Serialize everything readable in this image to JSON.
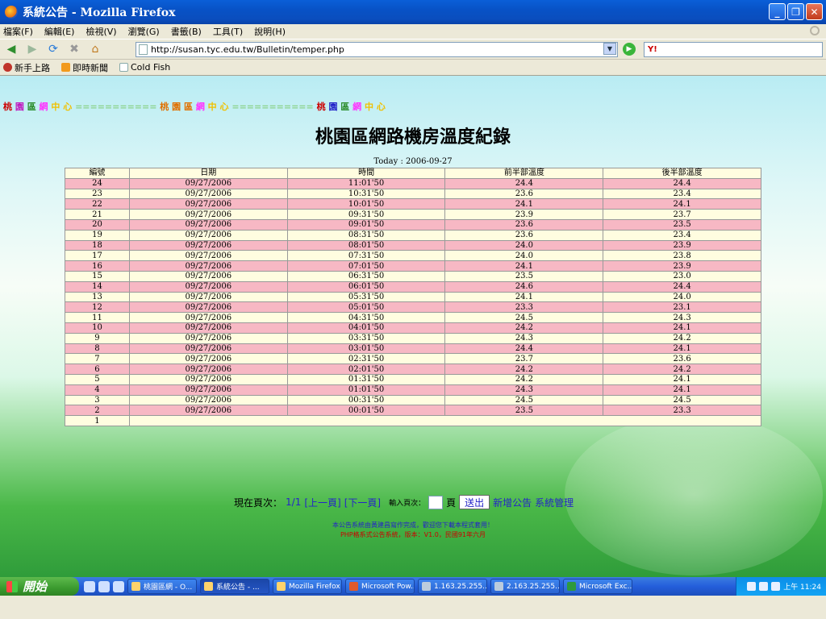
{
  "window": {
    "title": "系統公告 - Mozilla Firefox",
    "controls": [
      "_",
      "❐",
      "✕"
    ]
  },
  "menu": [
    "檔案(F)",
    "編輯(E)",
    "檢視(V)",
    "瀏覽(G)",
    "書籤(B)",
    "工具(T)",
    "說明(H)"
  ],
  "nav": {
    "url": "http://susan.tyc.edu.tw/Bulletin/temper.php",
    "search_logo": "Y!"
  },
  "bookmarks": [
    "新手上路",
    "即時新聞",
    "Cold Fish"
  ],
  "marquee": {
    "seg1": [
      "桃",
      "園",
      "區",
      "網",
      "中",
      "心"
    ],
    "sep": "==========="
  },
  "page": {
    "title": "桃園區網路機房溫度紀錄",
    "today": "Today : 2006-09-27",
    "columns": [
      "編號",
      "日期",
      "時間",
      "前半部溫度",
      "後半部溫度"
    ],
    "rows": [
      [
        "24",
        "09/27/2006",
        "11:01'50",
        "24.4",
        "24.4"
      ],
      [
        "23",
        "09/27/2006",
        "10:31'50",
        "23.6",
        "23.4"
      ],
      [
        "22",
        "09/27/2006",
        "10:01'50",
        "24.1",
        "24.1"
      ],
      [
        "21",
        "09/27/2006",
        "09:31'50",
        "23.9",
        "23.7"
      ],
      [
        "20",
        "09/27/2006",
        "09:01'50",
        "23.6",
        "23.5"
      ],
      [
        "19",
        "09/27/2006",
        "08:31'50",
        "23.6",
        "23.4"
      ],
      [
        "18",
        "09/27/2006",
        "08:01'50",
        "24.0",
        "23.9"
      ],
      [
        "17",
        "09/27/2006",
        "07:31'50",
        "24.0",
        "23.8"
      ],
      [
        "16",
        "09/27/2006",
        "07:01'50",
        "24.1",
        "23.9"
      ],
      [
        "15",
        "09/27/2006",
        "06:31'50",
        "23.5",
        "23.0"
      ],
      [
        "14",
        "09/27/2006",
        "06:01'50",
        "24.6",
        "24.4"
      ],
      [
        "13",
        "09/27/2006",
        "05:31'50",
        "24.1",
        "24.0"
      ],
      [
        "12",
        "09/27/2006",
        "05:01'50",
        "23.3",
        "23.1"
      ],
      [
        "11",
        "09/27/2006",
        "04:31'50",
        "24.5",
        "24.3"
      ],
      [
        "10",
        "09/27/2006",
        "04:01'50",
        "24.2",
        "24.1"
      ],
      [
        "9",
        "09/27/2006",
        "03:31'50",
        "24.3",
        "24.2"
      ],
      [
        "8",
        "09/27/2006",
        "03:01'50",
        "24.4",
        "24.1"
      ],
      [
        "7",
        "09/27/2006",
        "02:31'50",
        "23.7",
        "23.6"
      ],
      [
        "6",
        "09/27/2006",
        "02:01'50",
        "24.2",
        "24.2"
      ],
      [
        "5",
        "09/27/2006",
        "01:31'50",
        "24.2",
        "24.1"
      ],
      [
        "4",
        "09/27/2006",
        "01:01'50",
        "24.3",
        "24.1"
      ],
      [
        "3",
        "09/27/2006",
        "00:31'50",
        "24.5",
        "24.5"
      ],
      [
        "2",
        "09/27/2006",
        "00:01'50",
        "23.5",
        "23.3"
      ],
      [
        "1"
      ]
    ]
  },
  "pager": {
    "current_label": "現在頁次：",
    "current_value": "1/1",
    "prev": "[上一頁]",
    "next": "[下一頁]",
    "goto_label": "輸入頁次：",
    "page_suffix": "頁",
    "submit": "送出",
    "add_notice": "新增公告",
    "admin": "系統管理"
  },
  "footer": {
    "line1": "本公告系統由黃建昌寫作完成，歡迎您下載本程式套用！",
    "line2": "PHP格系式公告系統，版本：V1.0，民國91年六月"
  },
  "taskbar": {
    "start": "開始",
    "tasks": [
      "桃園區網 - O...",
      "系統公告 - ...",
      "Mozilla Firefox",
      "Microsoft Pow...",
      "1.163.25.255....",
      "2.163.25.255....",
      "Microsoft Exc..."
    ],
    "clock": "上午 11:24"
  }
}
